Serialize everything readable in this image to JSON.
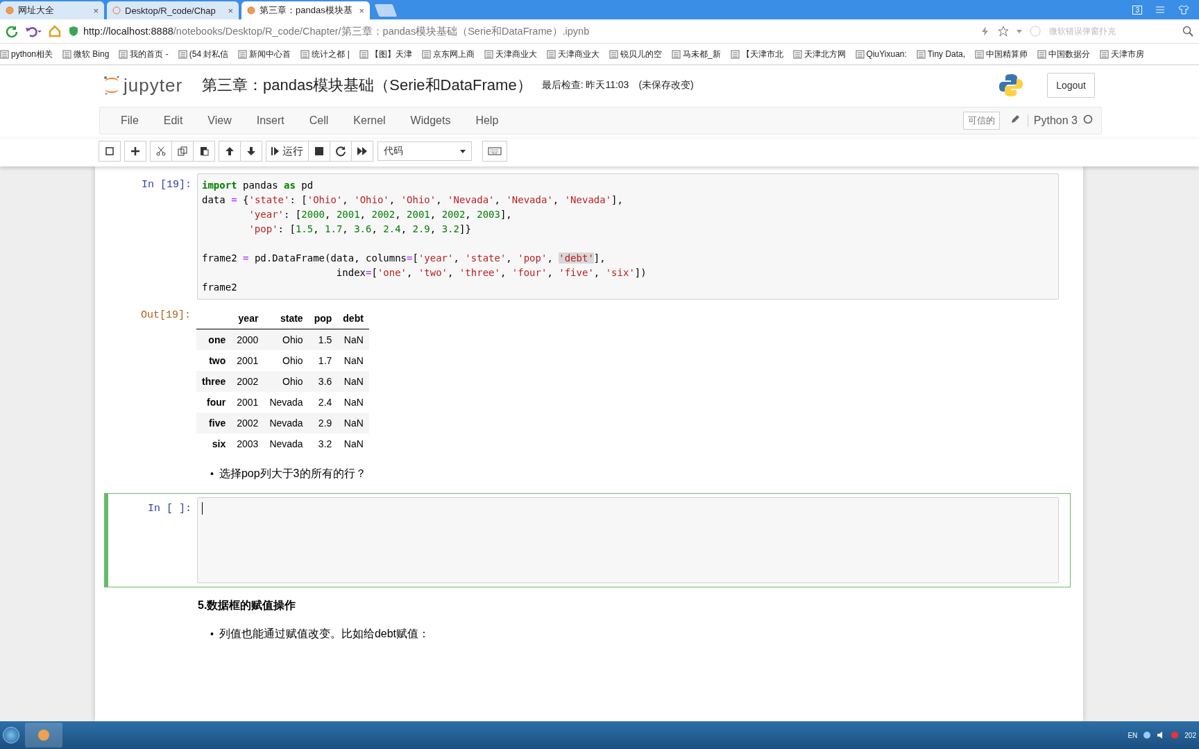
{
  "browser": {
    "tabs": [
      {
        "label": "网址大全",
        "selected": false,
        "close": "×"
      },
      {
        "label": "Desktop/R_code/Chap",
        "selected": false,
        "close": "×"
      },
      {
        "label": "第三章：pandas模块基",
        "selected": true,
        "close": "×"
      }
    ],
    "tab_count": "3",
    "url_host": "http://localhost:8888",
    "url_path": "/notebooks/Desktop/R_code/Chapter/第三章：pandas模块基础（Serie和DataFrame）.ipynb",
    "search_placeholder": "微软错误弹窗扑克",
    "bookmarks": [
      "python相关",
      "微软 Bing",
      "我的首页 -",
      "(54 封私信",
      "新闻中心首",
      "统计之都 |",
      "【图】天津",
      "京东网上商",
      "天津商业大",
      "天津商业大",
      "锐贝儿的空",
      "马未都_新",
      "【天津市北",
      "天津北方网",
      "QiuYixuan:",
      "Tiny Data,",
      "中国精算师",
      "中国数据分",
      "天津市房"
    ]
  },
  "notebook": {
    "logo_text": "jupyter",
    "title": "第三章：pandas模块基础（Serie和DataFrame）",
    "checkpoint": "最后检查: 昨天11:03",
    "save_status": "(未保存改变)",
    "logout": "Logout",
    "menu": [
      "File",
      "Edit",
      "View",
      "Insert",
      "Cell",
      "Kernel",
      "Widgets",
      "Help"
    ],
    "trusted": "可信的",
    "kernel": "Python 3",
    "run_label": "运行",
    "cell_type": "代码"
  },
  "cells": [
    {
      "kind": "code",
      "prompt": "In [19]:",
      "selected": false,
      "blocks": [
        {
          "lines": [
            {
              "tokens": [
                {
                  "text": "import",
                  "kind": "kw"
                },
                {
                  "text": " pandas ",
                  "kind": "plain"
                },
                {
                  "text": "as",
                  "kind": "kw"
                },
                {
                  "text": " pd",
                  "kind": "plain"
                }
              ]
            },
            {
              "tokens": [
                {
                  "text": "data ",
                  "kind": "plain"
                },
                {
                  "text": "=",
                  "kind": "op"
                },
                {
                  "text": " {",
                  "kind": "plain"
                },
                {
                  "text": "'state'",
                  "kind": "str"
                },
                {
                  "text": ": [",
                  "kind": "plain"
                },
                {
                  "text": "'Ohio'",
                  "kind": "str"
                },
                {
                  "text": ", ",
                  "kind": "plain"
                },
                {
                  "text": "'Ohio'",
                  "kind": "str"
                },
                {
                  "text": ", ",
                  "kind": "plain"
                },
                {
                  "text": "'Ohio'",
                  "kind": "str"
                },
                {
                  "text": ", ",
                  "kind": "plain"
                },
                {
                  "text": "'Nevada'",
                  "kind": "str"
                },
                {
                  "text": ", ",
                  "kind": "plain"
                },
                {
                  "text": "'Nevada'",
                  "kind": "str"
                },
                {
                  "text": ", ",
                  "kind": "plain"
                },
                {
                  "text": "'Nevada'",
                  "kind": "str"
                },
                {
                  "text": "],",
                  "kind": "plain"
                }
              ]
            },
            {
              "tokens": [
                {
                  "text": "        'year'",
                  "kind": "str"
                },
                {
                  "text": ": [",
                  "kind": "plain"
                },
                {
                  "text": "2000",
                  "kind": "num"
                },
                {
                  "text": ", ",
                  "kind": "plain"
                },
                {
                  "text": "2001",
                  "kind": "num"
                },
                {
                  "text": ", ",
                  "kind": "plain"
                },
                {
                  "text": "2002",
                  "kind": "num"
                },
                {
                  "text": ", ",
                  "kind": "plain"
                },
                {
                  "text": "2001",
                  "kind": "num"
                },
                {
                  "text": ", ",
                  "kind": "plain"
                },
                {
                  "text": "2002",
                  "kind": "num"
                },
                {
                  "text": ", ",
                  "kind": "plain"
                },
                {
                  "text": "2003",
                  "kind": "num"
                },
                {
                  "text": "],",
                  "kind": "plain"
                }
              ]
            },
            {
              "tokens": [
                {
                  "text": "        'pop'",
                  "kind": "str"
                },
                {
                  "text": ": [",
                  "kind": "plain"
                },
                {
                  "text": "1.5",
                  "kind": "num"
                },
                {
                  "text": ", ",
                  "kind": "plain"
                },
                {
                  "text": "1.7",
                  "kind": "num"
                },
                {
                  "text": ", ",
                  "kind": "plain"
                },
                {
                  "text": "3.6",
                  "kind": "num"
                },
                {
                  "text": ", ",
                  "kind": "plain"
                },
                {
                  "text": "2.4",
                  "kind": "num"
                },
                {
                  "text": ", ",
                  "kind": "plain"
                },
                {
                  "text": "2.9",
                  "kind": "num"
                },
                {
                  "text": ", ",
                  "kind": "plain"
                },
                {
                  "text": "3.2",
                  "kind": "num"
                },
                {
                  "text": "]}",
                  "kind": "plain"
                }
              ]
            }
          ]
        },
        {
          "lines": [
            {
              "tokens": [
                {
                  "text": "frame2 ",
                  "kind": "plain"
                },
                {
                  "text": "=",
                  "kind": "op"
                },
                {
                  "text": " pd.DataFrame(data, columns",
                  "kind": "plain"
                },
                {
                  "text": "=",
                  "kind": "op"
                },
                {
                  "text": "[",
                  "kind": "plain"
                },
                {
                  "text": "'year'",
                  "kind": "str"
                },
                {
                  "text": ", ",
                  "kind": "plain"
                },
                {
                  "text": "'state'",
                  "kind": "str"
                },
                {
                  "text": ", ",
                  "kind": "plain"
                },
                {
                  "text": "'pop'",
                  "kind": "str"
                },
                {
                  "text": ", ",
                  "kind": "plain"
                },
                {
                  "text": "'debt'",
                  "kind": "highlight"
                },
                {
                  "text": "],",
                  "kind": "plain"
                }
              ]
            },
            {
              "tokens": [
                {
                  "text": "                       index",
                  "kind": "plain"
                },
                {
                  "text": "=",
                  "kind": "op"
                },
                {
                  "text": "[",
                  "kind": "plain"
                },
                {
                  "text": "'one'",
                  "kind": "str"
                },
                {
                  "text": ", ",
                  "kind": "plain"
                },
                {
                  "text": "'two'",
                  "kind": "str"
                },
                {
                  "text": ", ",
                  "kind": "plain"
                },
                {
                  "text": "'three'",
                  "kind": "str"
                },
                {
                  "text": ", ",
                  "kind": "plain"
                },
                {
                  "text": "'four'",
                  "kind": "str"
                },
                {
                  "text": ", ",
                  "kind": "plain"
                },
                {
                  "text": "'five'",
                  "kind": "str"
                },
                {
                  "text": ", ",
                  "kind": "plain"
                },
                {
                  "text": "'six'",
                  "kind": "str"
                },
                {
                  "text": "])",
                  "kind": "plain"
                }
              ]
            },
            {
              "tokens": [
                {
                  "text": "frame2",
                  "kind": "plain"
                }
              ]
            }
          ]
        }
      ],
      "out_prompt": "Out[19]:",
      "table": {
        "columns": [
          "year",
          "state",
          "pop",
          "debt"
        ],
        "rows": [
          {
            "index": "one",
            "cells": [
              "2000",
              "Ohio",
              "1.5",
              "NaN"
            ]
          },
          {
            "index": "two",
            "cells": [
              "2001",
              "Ohio",
              "1.7",
              "NaN"
            ]
          },
          {
            "index": "three",
            "cells": [
              "2002",
              "Ohio",
              "3.6",
              "NaN"
            ]
          },
          {
            "index": "four",
            "cells": [
              "2001",
              "Nevada",
              "2.4",
              "NaN"
            ]
          },
          {
            "index": "five",
            "cells": [
              "2002",
              "Nevada",
              "2.9",
              "NaN"
            ]
          },
          {
            "index": "six",
            "cells": [
              "2003",
              "Nevada",
              "3.2",
              "NaN"
            ]
          }
        ]
      }
    },
    {
      "kind": "markdown",
      "bullets": [
        {
          "marker": "•",
          "text": "选择pop列大于3的所有的行？"
        }
      ]
    },
    {
      "kind": "code",
      "prompt": "In [ ]:",
      "selected": true
    },
    {
      "kind": "markdown",
      "heading": "5.数据框的赋值操作",
      "bullets": [
        {
          "marker": "•",
          "text": "列值也能通过赋值改变。比如给debt赋值："
        }
      ]
    }
  ],
  "taskbar": {
    "lang": "EN",
    "clock": "202"
  }
}
